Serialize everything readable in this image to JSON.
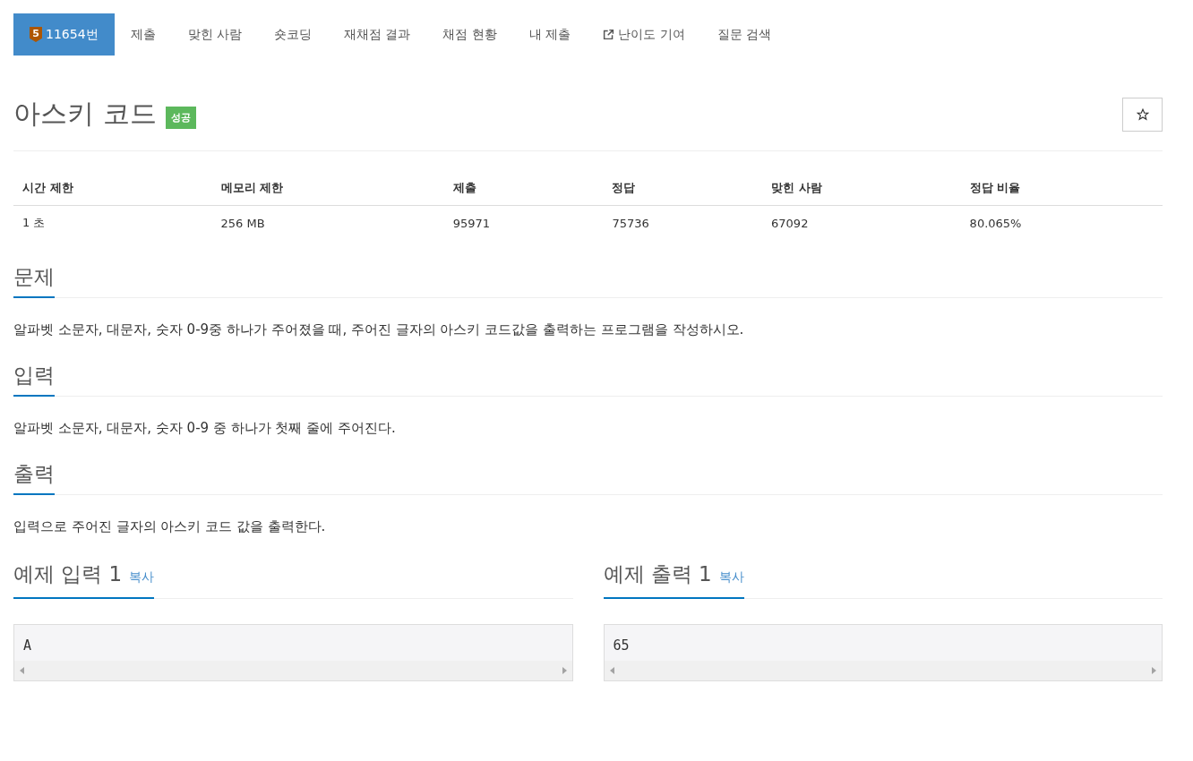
{
  "tabs": [
    {
      "label": "11654번",
      "selected": true,
      "kind": "problem",
      "tier": "5"
    },
    {
      "label": "제출",
      "selected": false,
      "kind": "plain"
    },
    {
      "label": "맞힌 사람",
      "selected": false,
      "kind": "plain"
    },
    {
      "label": "숏코딩",
      "selected": false,
      "kind": "plain"
    },
    {
      "label": "재채점 결과",
      "selected": false,
      "kind": "plain"
    },
    {
      "label": "채점 현황",
      "selected": false,
      "kind": "plain"
    },
    {
      "label": "내 제출",
      "selected": false,
      "kind": "plain"
    },
    {
      "label": "난이도 기여",
      "selected": false,
      "kind": "external"
    },
    {
      "label": "질문 검색",
      "selected": false,
      "kind": "plain"
    }
  ],
  "title": "아스키 코드",
  "status_label": "성공",
  "starred": false,
  "info_table": {
    "columns": [
      "시간 제한",
      "메모리 제한",
      "제출",
      "정답",
      "맞힌 사람",
      "정답 비율"
    ],
    "row": [
      "1 초",
      "256 MB",
      "95971",
      "75736",
      "67092",
      "80.065%"
    ]
  },
  "sections": [
    {
      "heading": "문제",
      "text": "알파벳 소문자, 대문자, 숫자 0-9중 하나가 주어졌을 때, 주어진 글자의 아스키 코드값을 출력하는 프로그램을 작성하시오."
    },
    {
      "heading": "입력",
      "text": "알파벳 소문자, 대문자, 숫자 0-9 중 하나가 첫째 줄에 주어진다."
    },
    {
      "heading": "출력",
      "text": "입력으로 주어진 글자의 아스키 코드 값을 출력한다."
    }
  ],
  "samples": [
    {
      "heading": "예제 입력 1",
      "copy": "복사",
      "content": "A"
    },
    {
      "heading": "예제 출력 1",
      "copy": "복사",
      "content": "65"
    }
  ]
}
